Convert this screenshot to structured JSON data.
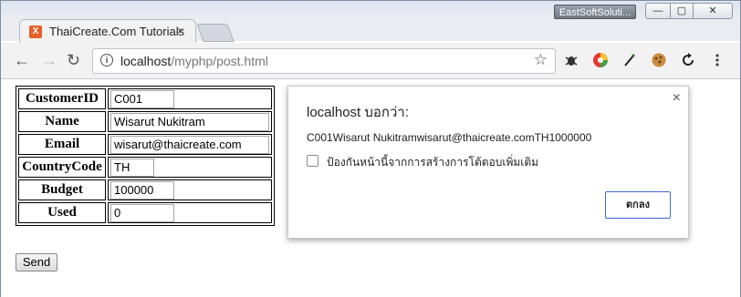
{
  "window": {
    "user_badge": "EastSoftSoluti...",
    "min_label": "—",
    "max_label": "▢",
    "close_label": "✕"
  },
  "tab": {
    "title": "ThaiCreate.Com Tutorials",
    "favicon_letter": "X",
    "close_label": "×"
  },
  "toolbar": {
    "back_label": "←",
    "forward_label": "→",
    "reload_label": "↻",
    "url_host": "localhost",
    "url_path": "/myphp/post.html",
    "info_label": "i",
    "star_label": "☆",
    "extensions": [
      "bug-icon",
      "color-wheel-icon",
      "pen-icon",
      "cookie-icon",
      "sync-icon",
      "menu-icon"
    ]
  },
  "form": {
    "rows": [
      {
        "label": "CustomerID",
        "value": "C001"
      },
      {
        "label": "Name",
        "value": "Wisarut Nukitram"
      },
      {
        "label": "Email",
        "value": "wisarut@thaicreate.com"
      },
      {
        "label": "CountryCode",
        "value": "TH"
      },
      {
        "label": "Budget",
        "value": "100000"
      },
      {
        "label": "Used",
        "value": "0"
      }
    ],
    "send_label": "Send"
  },
  "dialog": {
    "title": "localhost บอกว่า:",
    "message": "C001Wisarut Nukitramwisarut@thaicreate.comTH1000000",
    "checkbox_label": "ป้องกันหน้านี้จากการสร้างการโต้ตอบเพิ่มเติม",
    "ok_label": "ตกลง",
    "close_label": "×"
  }
}
